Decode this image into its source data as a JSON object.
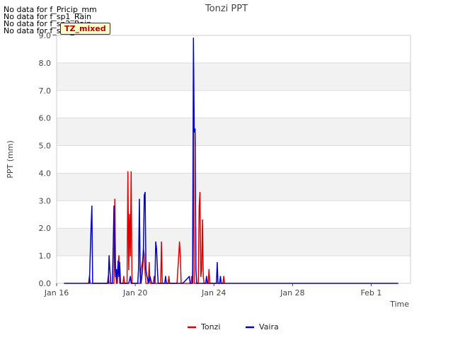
{
  "notices": [
    "No data for f_Pricip_mm",
    "No data for f_sp1_Rain",
    "No data for f_sp2_Rain",
    "No data for f_sp3_Rain"
  ],
  "tag_label": "TZ_mixed",
  "colors": {
    "tonzi": "#dd0000",
    "vaira": "#0000cc",
    "band": "#f2f2f2",
    "grid": "#dddddd"
  },
  "chart_data": {
    "type": "line",
    "title": "Tonzi PPT",
    "xlabel": "Time",
    "ylabel": "PPT (mm)",
    "xlim": [
      "2024-01-16",
      "2024-02-03"
    ],
    "ylim": [
      0,
      9
    ],
    "x_ticks": [
      "Jan 16",
      "Jan 20",
      "Jan 24",
      "Jan 28",
      "Feb 1"
    ],
    "x_tick_dates": [
      "2024-01-16",
      "2024-01-20",
      "2024-01-24",
      "2024-01-28",
      "2024-02-01"
    ],
    "y_ticks": [
      "0.0",
      "1.0",
      "2.0",
      "3.0",
      "4.0",
      "5.0",
      "6.0",
      "7.0",
      "8.0",
      "9.0"
    ],
    "grid": true,
    "legend_position": "bottom-center",
    "series": [
      {
        "name": "Tonzi",
        "color": "#dd0000",
        "points": [
          [
            "2024-01-17 15:00",
            0
          ],
          [
            "2024-01-17 16:00",
            0.25
          ],
          [
            "2024-01-17 17:00",
            0
          ],
          [
            "2024-01-18 14:00",
            0
          ],
          [
            "2024-01-18 15:00",
            0.25
          ],
          [
            "2024-01-18 16:00",
            0
          ],
          [
            "2024-01-18 22:00",
            0
          ],
          [
            "2024-01-18 23:00",
            3.05
          ],
          [
            "2024-01-19 00:00",
            0.5
          ],
          [
            "2024-01-19 01:00",
            0
          ],
          [
            "2024-01-19 04:00",
            1.0
          ],
          [
            "2024-01-19 05:00",
            0
          ],
          [
            "2024-01-19 09:00",
            0
          ],
          [
            "2024-01-19 10:00",
            0.25
          ],
          [
            "2024-01-19 11:00",
            0
          ],
          [
            "2024-01-19 14:00",
            0
          ],
          [
            "2024-01-19 15:00",
            4.05
          ],
          [
            "2024-01-19 16:00",
            0.5
          ],
          [
            "2024-01-19 17:00",
            2.5
          ],
          [
            "2024-01-19 18:00",
            1.0
          ],
          [
            "2024-01-19 19:00",
            4.05
          ],
          [
            "2024-01-19 20:00",
            0
          ],
          [
            "2024-01-20 06:00",
            0
          ],
          [
            "2024-01-20 07:00",
            0.5
          ],
          [
            "2024-01-20 09:00",
            0.8
          ],
          [
            "2024-01-20 10:00",
            1.25
          ],
          [
            "2024-01-20 11:00",
            1.05
          ],
          [
            "2024-01-20 12:00",
            0.4
          ],
          [
            "2024-01-20 13:00",
            0
          ],
          [
            "2024-01-20 16:00",
            0
          ],
          [
            "2024-01-20 17:00",
            0.75
          ],
          [
            "2024-01-20 18:00",
            0
          ],
          [
            "2024-01-20 22:00",
            0
          ],
          [
            "2024-01-20 23:00",
            0.25
          ],
          [
            "2024-01-21 00:00",
            0
          ],
          [
            "2024-01-21 07:00",
            0
          ],
          [
            "2024-01-21 08:00",
            1.5
          ],
          [
            "2024-01-21 09:00",
            0
          ],
          [
            "2024-01-21 16:00",
            0
          ],
          [
            "2024-01-21 17:00",
            0.25
          ],
          [
            "2024-01-21 18:00",
            0
          ],
          [
            "2024-01-22 03:00",
            0
          ],
          [
            "2024-01-22 05:00",
            1.0
          ],
          [
            "2024-01-22 06:00",
            1.5
          ],
          [
            "2024-01-22 07:00",
            1.0
          ],
          [
            "2024-01-22 08:00",
            0
          ],
          [
            "2024-01-22 20:00",
            0
          ],
          [
            "2024-01-22 21:00",
            0.25
          ],
          [
            "2024-01-22 22:00",
            0
          ],
          [
            "2024-01-22 23:00",
            6.1
          ],
          [
            "2024-01-23 00:00",
            0
          ],
          [
            "2024-01-23 05:00",
            0
          ],
          [
            "2024-01-23 06:00",
            2.8
          ],
          [
            "2024-01-23 07:00",
            3.3
          ],
          [
            "2024-01-23 08:00",
            0.25
          ],
          [
            "2024-01-23 09:00",
            0.5
          ],
          [
            "2024-01-23 10:00",
            2.3
          ],
          [
            "2024-01-23 11:00",
            0.25
          ],
          [
            "2024-01-23 12:00",
            0
          ],
          [
            "2024-01-23 17:00",
            0
          ],
          [
            "2024-01-23 18:00",
            0.5
          ],
          [
            "2024-01-23 19:00",
            0
          ],
          [
            "2024-01-24 11:00",
            0
          ],
          [
            "2024-01-24 12:00",
            0.25
          ],
          [
            "2024-01-24 13:00",
            0
          ]
        ]
      },
      {
        "name": "Vaira",
        "color": "#0000cc",
        "points": [
          [
            "2024-01-16 09:00",
            0
          ],
          [
            "2024-01-17 16:00",
            0
          ],
          [
            "2024-01-17 18:00",
            2.0
          ],
          [
            "2024-01-17 19:00",
            2.8
          ],
          [
            "2024-01-17 20:00",
            0
          ],
          [
            "2024-01-18 15:00",
            0
          ],
          [
            "2024-01-18 16:00",
            1.0
          ],
          [
            "2024-01-18 17:00",
            0.5
          ],
          [
            "2024-01-18 18:00",
            0
          ],
          [
            "2024-01-18 20:00",
            0
          ],
          [
            "2024-01-18 21:00",
            1.25
          ],
          [
            "2024-01-18 22:00",
            2.8
          ],
          [
            "2024-01-18 23:00",
            1.0
          ],
          [
            "2024-01-19 00:00",
            0.25
          ],
          [
            "2024-01-19 01:00",
            0.5
          ],
          [
            "2024-01-19 02:00",
            0
          ],
          [
            "2024-01-19 03:00",
            0.8
          ],
          [
            "2024-01-19 04:00",
            0.25
          ],
          [
            "2024-01-19 05:00",
            0.75
          ],
          [
            "2024-01-19 06:00",
            0
          ],
          [
            "2024-01-19 16:00",
            0
          ],
          [
            "2024-01-19 18:00",
            0.25
          ],
          [
            "2024-01-19 19:00",
            0
          ],
          [
            "2024-01-20 03:00",
            0
          ],
          [
            "2024-01-20 04:00",
            0.5
          ],
          [
            "2024-01-20 05:00",
            3.05
          ],
          [
            "2024-01-20 06:00",
            0.25
          ],
          [
            "2024-01-20 07:00",
            0
          ],
          [
            "2024-01-20 09:00",
            0.5
          ],
          [
            "2024-01-20 10:00",
            1.25
          ],
          [
            "2024-01-20 11:00",
            3.2
          ],
          [
            "2024-01-20 12:00",
            3.3
          ],
          [
            "2024-01-20 13:00",
            0.5
          ],
          [
            "2024-01-20 14:00",
            0.3
          ],
          [
            "2024-01-20 16:00",
            0
          ],
          [
            "2024-01-20 18:00",
            0.25
          ],
          [
            "2024-01-20 20:00",
            0
          ],
          [
            "2024-01-21 00:00",
            0
          ],
          [
            "2024-01-21 01:00",
            1.5
          ],
          [
            "2024-01-21 02:00",
            1.25
          ],
          [
            "2024-01-21 03:00",
            0.5
          ],
          [
            "2024-01-21 04:00",
            0
          ],
          [
            "2024-01-21 12:00",
            0
          ],
          [
            "2024-01-21 13:00",
            0.25
          ],
          [
            "2024-01-21 14:00",
            0
          ],
          [
            "2024-01-22 10:00",
            0
          ],
          [
            "2024-01-22 18:00",
            0.25
          ],
          [
            "2024-01-22 19:00",
            0
          ],
          [
            "2024-01-22 22:00",
            0
          ],
          [
            "2024-01-22 23:00",
            8.9
          ],
          [
            "2024-01-23 00:00",
            5.5
          ],
          [
            "2024-01-23 01:00",
            5.6
          ],
          [
            "2024-01-23 02:00",
            0.5
          ],
          [
            "2024-01-23 03:00",
            0
          ],
          [
            "2024-01-23 14:00",
            0
          ],
          [
            "2024-01-23 15:00",
            0.25
          ],
          [
            "2024-01-23 16:00",
            0
          ],
          [
            "2024-01-24 03:00",
            0
          ],
          [
            "2024-01-24 04:00",
            0.75
          ],
          [
            "2024-01-24 05:00",
            0
          ],
          [
            "2024-01-24 07:00",
            0
          ],
          [
            "2024-01-24 08:00",
            0.25
          ],
          [
            "2024-01-24 09:00",
            0
          ],
          [
            "2024-02-02 09:00",
            0
          ]
        ]
      }
    ]
  }
}
